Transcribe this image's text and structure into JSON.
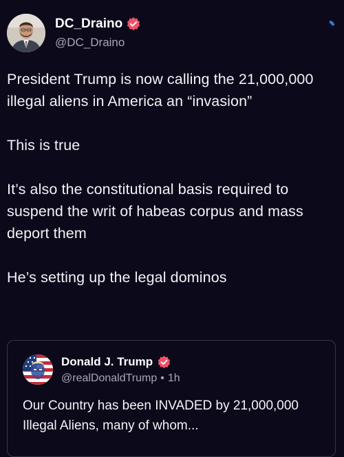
{
  "post": {
    "author": {
      "display_name": "DC_Draino",
      "handle": "@DC_Draino",
      "verified": true
    },
    "paragraphs": [
      "President Trump is now calling the 21,000,000 illegal aliens in America an “invasion”",
      "This is true",
      "It’s also the constitutional basis required to suspend the writ of habeas corpus and mass deport them",
      "He’s setting up the legal dominos"
    ],
    "quoted_post": {
      "author": {
        "display_name": "Donald J. Trump",
        "handle": "@realDonaldTrump",
        "verified": true
      },
      "separator": "•",
      "time": "1h",
      "text": "Our Country has been INVADED by 21,000,000 Illegal Aliens, many of whom..."
    }
  },
  "colors": {
    "background": "#0c0a1a",
    "badge": "#f2506a",
    "secondary_text": "#a9a7b6",
    "quote_border": "#3a3648",
    "corner_accent": "#2f80d8"
  },
  "icons": {
    "badge": "verified-badge-icon",
    "corner": "corner-indicator-icon"
  }
}
